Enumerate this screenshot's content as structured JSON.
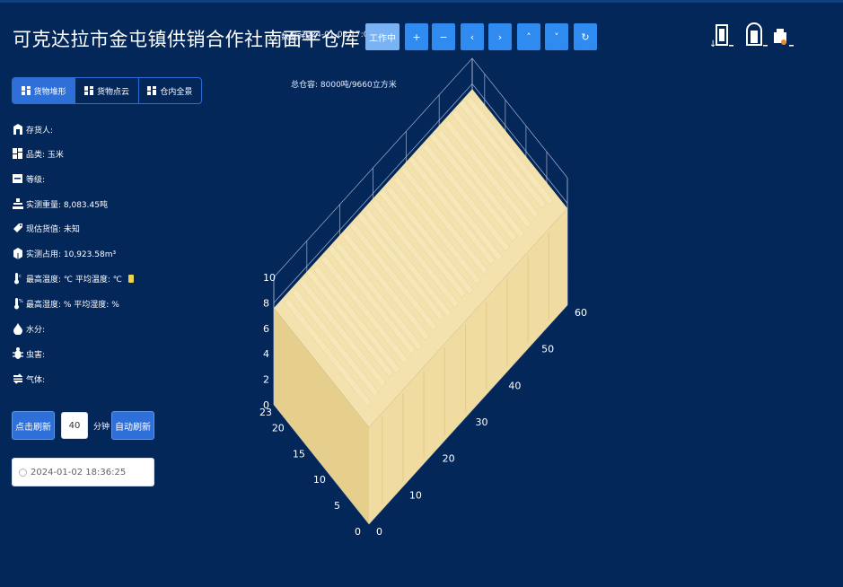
{
  "header": {
    "title": "可克达拉市金屯镇供销合作社南面平仓库",
    "data_time_label": "数据时间:",
    "data_time_value": "2024-01-02 17:00:00",
    "status": "工作中",
    "controls": [
      {
        "name": "zoom-in-button",
        "glyph": "+"
      },
      {
        "name": "zoom-out-button",
        "glyph": "−"
      },
      {
        "name": "rotate-left-button",
        "glyph": "‹"
      },
      {
        "name": "rotate-right-button",
        "glyph": "›"
      },
      {
        "name": "tilt-up-button",
        "glyph": "˄"
      },
      {
        "name": "tilt-down-button",
        "glyph": "˅"
      },
      {
        "name": "reset-view-button",
        "glyph": "↻"
      }
    ]
  },
  "capacity": "总仓容: 8000吨/9660立方米",
  "tabs": [
    {
      "label": "货物堆形",
      "active": true
    },
    {
      "label": "货物点云",
      "active": false
    },
    {
      "label": "仓内全景",
      "active": false
    }
  ],
  "info": {
    "depositor": "存货人:",
    "variety": "品类: 玉米",
    "grade": "等级:",
    "measured_weight": "实测重量: 8,083.45吨",
    "estimated_value": "现估货值: 未知",
    "measured_volume": "实测占用: 10,923.58m³",
    "temperature": "最高温度: ℃  平均温度: ℃",
    "humidity": "最高湿度: %  平均湿度: %",
    "moisture": "水分:",
    "pests": "虫害:",
    "gas": "气体:"
  },
  "refresh": {
    "manual_label": "点击刷新",
    "interval_value": "40",
    "interval_unit": "分钟",
    "auto_label": "自动刷新"
  },
  "datetime_value": "2024-01-02 18:36:25",
  "chart_data": {
    "type": "surface3d",
    "axes": {
      "x": {
        "range": [
          0,
          23
        ],
        "ticks": [
          0,
          5,
          10,
          15,
          20,
          23
        ]
      },
      "y": {
        "range": [
          0,
          60
        ],
        "ticks": [
          0,
          10,
          20,
          30,
          40,
          50,
          60
        ]
      },
      "z": {
        "range": [
          0,
          10
        ],
        "ticks": [
          0,
          2,
          4,
          6,
          8,
          10
        ]
      }
    },
    "surface_color": "#f0dca0",
    "surface_mean_height": 7.6,
    "grid": true
  },
  "colors": {
    "background": "#04275a",
    "accent": "#2f8bf0",
    "status": "#7ab3f3",
    "tab_active": "#2f6fd8"
  }
}
